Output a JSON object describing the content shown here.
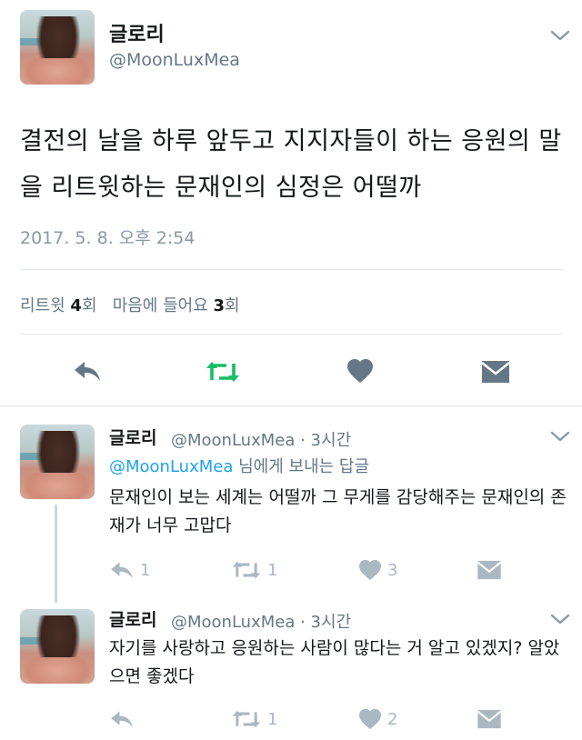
{
  "main_tweet": {
    "display_name": "글로리",
    "handle": "@MoonLuxMea",
    "text": "결전의 날을 하루 앞두고 지지자들이 하는 응원의 말을 리트윗하는 문재인의 심정은 어떨까",
    "timestamp": "2017. 5. 8. 오후 2:54",
    "stats": {
      "retweet_label": "리트윗",
      "retweet_count": "4",
      "retweet_unit": "회",
      "like_label": "마음에 들어요",
      "like_count": "3",
      "like_unit": "회"
    },
    "icons": [
      "reply-icon",
      "retweet-icon",
      "like-icon",
      "direct-message-icon"
    ],
    "colors": {
      "retweet_active": "#17bf63",
      "icon_gray": "#657786"
    }
  },
  "replies": [
    {
      "display_name": "글로리",
      "handle": "@MoonLuxMea",
      "time": "· 3시간",
      "reply_to_mention": "@MoonLuxMea",
      "reply_to_suffix": "님에게 보내는 답글",
      "text": "문재인이 보는 세계는 어떨까 그 무게를 감당해주는 문재인의 존재가 너무 고맙다",
      "reply_count": "1",
      "retweet_count": "1",
      "like_count": "3"
    },
    {
      "display_name": "글로리",
      "handle": "@MoonLuxMea",
      "time": "· 3시간",
      "text": "자기를 사랑하고 응원하는 사람이 많다는 거 알고 있겠지? 알았으면 좋겠다",
      "reply_count": "",
      "retweet_count": "1",
      "like_count": "2"
    }
  ]
}
